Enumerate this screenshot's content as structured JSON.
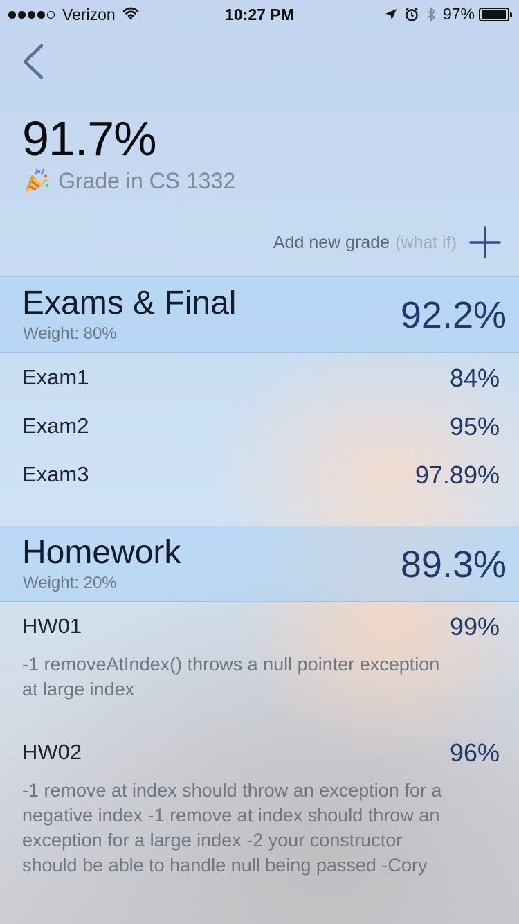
{
  "status_bar": {
    "carrier": "Verizon",
    "time": "10:27 PM",
    "battery": "97%",
    "battery_level": 0.97,
    "signal_bars_filled": 4,
    "signal_bars_total": 5,
    "icons": [
      "wifi-icon",
      "location-icon",
      "alarm-icon",
      "bluetooth-icon",
      "battery-icon"
    ]
  },
  "header": {
    "grade": "91.7%",
    "course_label": "Grade in CS 1332",
    "emoji": "party-popper-icon"
  },
  "add_grade": {
    "label": "Add new grade",
    "hint": "(what if)"
  },
  "categories": [
    {
      "name": "Exams & Final",
      "weight": "Weight: 80%",
      "grade": "92.2%",
      "items": [
        {
          "name": "Exam1",
          "grade": "84%"
        },
        {
          "name": "Exam2",
          "grade": "95%"
        },
        {
          "name": "Exam3",
          "grade": "97.89%"
        }
      ]
    },
    {
      "name": "Homework",
      "weight": "Weight: 20%",
      "grade": "89.3%",
      "items": [
        {
          "name": "HW01",
          "grade": "99%",
          "comment": "-1 removeAtIndex() throws a null pointer exception at large index"
        },
        {
          "name": "HW02",
          "grade": "96%",
          "comment": "-1 remove at index should throw an exception for a negative index -1 remove at index should throw an exception for a large index -2 your constructor should be able to handle null being passed -Cory"
        }
      ]
    }
  ],
  "colors": {
    "accent": "#1f3a6a",
    "back_arrow": "#5a6c9a",
    "category_band": "#aad2f5"
  }
}
